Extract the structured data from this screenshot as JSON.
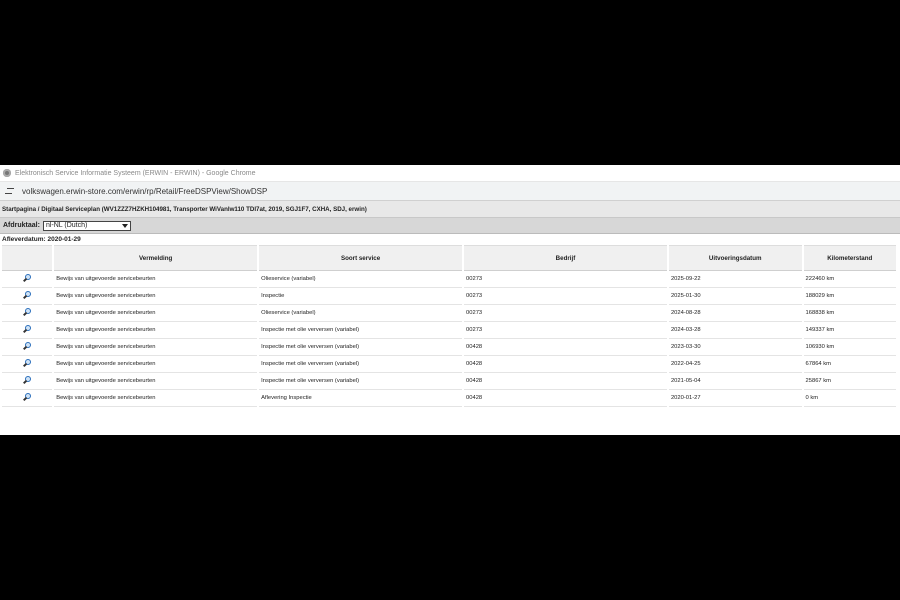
{
  "window": {
    "title": "Elektronisch Service Informatie Systeem (ERWIN - ERWIN) - Google Chrome"
  },
  "address": {
    "url": "volkswagen.erwin-store.com/erwin/rp/Retail/FreeDSPView/ShowDSP"
  },
  "breadcrumb": {
    "text": "Startpagina / Digitaal Serviceplan (WV1ZZZ7HZKH104981, Transporter WiVanlw110 TDI7at, 2019, SGJ1F7, CXHA, SDJ, erwin)"
  },
  "toolbar": {
    "label": "Afdruktaal:",
    "language": "nl-NL (Dutch)"
  },
  "delivery": {
    "text": "Afleverdatum: 2020-01-29"
  },
  "table": {
    "headers": [
      "Vermelding",
      "Soort service",
      "Bedrijf",
      "Uitvoeringsdatum",
      "Kilometerstand"
    ],
    "rows": [
      {
        "vermelding": "Bewijs van uitgevoerde servicebeurten",
        "soort": "Olieservice (variabel)",
        "bedrijf": "00273",
        "datum": "2025-09-22",
        "km": "222460 km"
      },
      {
        "vermelding": "Bewijs van uitgevoerde servicebeurten",
        "soort": "Inspectie",
        "bedrijf": "00273",
        "datum": "2025-01-30",
        "km": "188029 km"
      },
      {
        "vermelding": "Bewijs van uitgevoerde servicebeurten",
        "soort": "Olieservice (variabel)",
        "bedrijf": "00273",
        "datum": "2024-08-28",
        "km": "168838 km"
      },
      {
        "vermelding": "Bewijs van uitgevoerde servicebeurten",
        "soort": "Inspectie met olie verversen (variabel)",
        "bedrijf": "00273",
        "datum": "2024-03-28",
        "km": "149337 km"
      },
      {
        "vermelding": "Bewijs van uitgevoerde servicebeurten",
        "soort": "Inspectie met olie verversen (variabel)",
        "bedrijf": "00428",
        "datum": "2023-03-30",
        "km": "106930 km"
      },
      {
        "vermelding": "Bewijs van uitgevoerde servicebeurten",
        "soort": "Inspectie met olie verversen (variabel)",
        "bedrijf": "00428",
        "datum": "2022-04-25",
        "km": "67864 km"
      },
      {
        "vermelding": "Bewijs van uitgevoerde servicebeurten",
        "soort": "Inspectie met olie verversen (variabel)",
        "bedrijf": "00428",
        "datum": "2021-05-04",
        "km": "25867 km"
      },
      {
        "vermelding": "Bewijs van uitgevoerde servicebeurten",
        "soort": "Aflevering Inspectie",
        "bedrijf": "00428",
        "datum": "2020-01-27",
        "km": "0 km"
      }
    ]
  }
}
